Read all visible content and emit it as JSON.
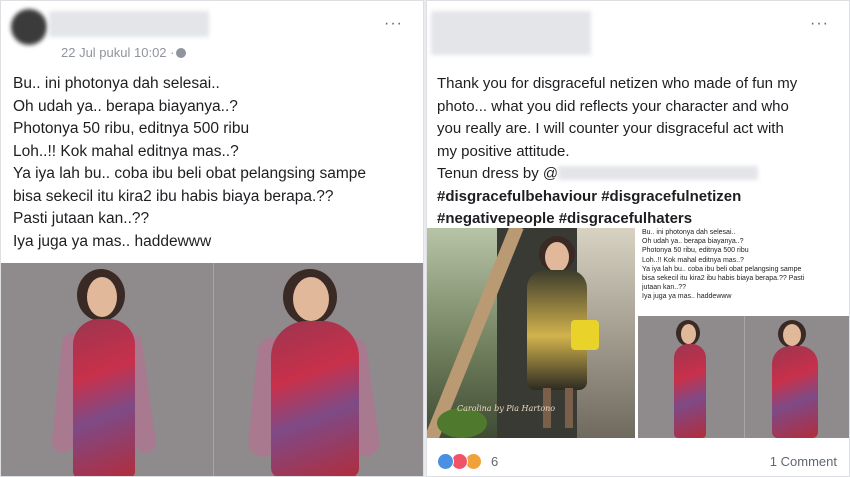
{
  "left_post": {
    "meta": "22 Jul pukul 10:02 ·",
    "more": "···",
    "lines": [
      "Bu.. ini photonya dah selesai..",
      "Oh udah ya.. berapa biayanya..?",
      "Photonya 50 ribu, editnya 500 ribu",
      "Loh..!! Kok mahal editnya mas..?",
      "Ya iya lah bu.. coba ibu beli obat pelangsing sampe",
      "bisa sekecil itu kira2 ibu habis biaya berapa.??",
      "Pasti jutaan kan..??",
      "Iya juga ya mas.. haddewww"
    ]
  },
  "right_post": {
    "more": "···",
    "lines": [
      "Thank you for disgraceful netizen who made of fun my",
      "photo... what you did reflects your character and who",
      "you really are. I will counter your disgraceful act with",
      "my positive attitude.",
      "Tenun dress by @"
    ],
    "hashtags": [
      "#disgracefulbehaviour #disgracefulnetizen",
      "#negativepeople #disgracefulhaters"
    ],
    "watermark": "Carolina by Pia Hartono",
    "inner_lines": [
      "Bu.. ini photonya dah selesai..",
      "Oh udah ya.. berapa biayanya..?",
      "Photonya 50 ribu, editnya 500 ribu",
      "Loh..!! Kok mahal editnya mas..?",
      "Ya iya lah bu.. coba ibu beli obat pelangsing sampe",
      "bisa sekecil itu kira2 ibu habis biaya berapa.?? Pasti",
      "jutaan kan..??",
      "Iya juga ya mas.. haddewww"
    ],
    "reactions": [
      "like-icon",
      "love-icon",
      "angry-icon"
    ],
    "reaction_count": "6",
    "comments": "1 Comment"
  }
}
